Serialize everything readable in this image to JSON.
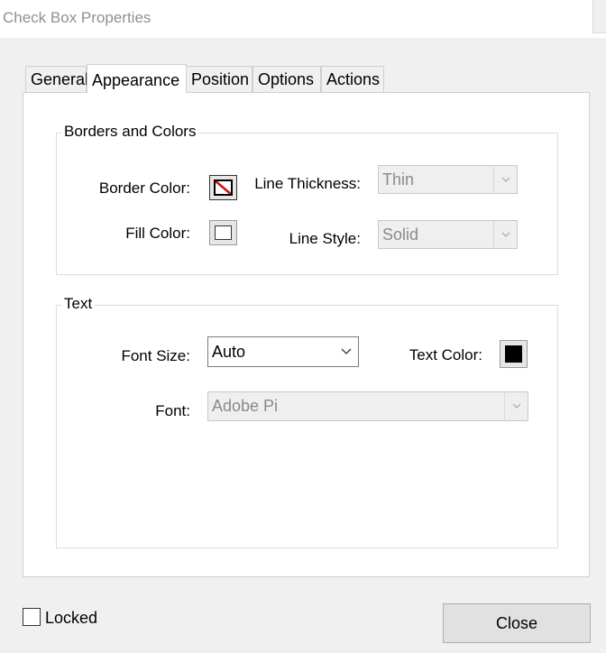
{
  "window": {
    "title": "Check Box Properties"
  },
  "tabs": [
    {
      "label": "General",
      "active": false
    },
    {
      "label": "Appearance",
      "active": true
    },
    {
      "label": "Position",
      "active": false
    },
    {
      "label": "Options",
      "active": false
    },
    {
      "label": "Actions",
      "active": false
    }
  ],
  "borders_and_colors": {
    "group_title": "Borders and Colors",
    "border_color_label": "Border Color:",
    "fill_color_label": "Fill Color:",
    "line_thickness_label": "Line Thickness:",
    "line_thickness_value": "Thin",
    "line_style_label": "Line Style:",
    "line_style_value": "Solid",
    "border_color_swatch": "transparent-red-slash",
    "fill_color_swatch": "#ffffff"
  },
  "text": {
    "group_title": "Text",
    "font_size_label": "Font Size:",
    "font_size_value": "Auto",
    "text_color_label": "Text Color:",
    "text_color_swatch": "#000000",
    "font_label": "Font:",
    "font_value": "Adobe Pi"
  },
  "footer": {
    "locked_label": "Locked",
    "locked_checked": false,
    "close_label": "Close"
  },
  "icons": {
    "dropdown": "chevron-down-icon",
    "no_color": "no-color-slash-icon"
  }
}
